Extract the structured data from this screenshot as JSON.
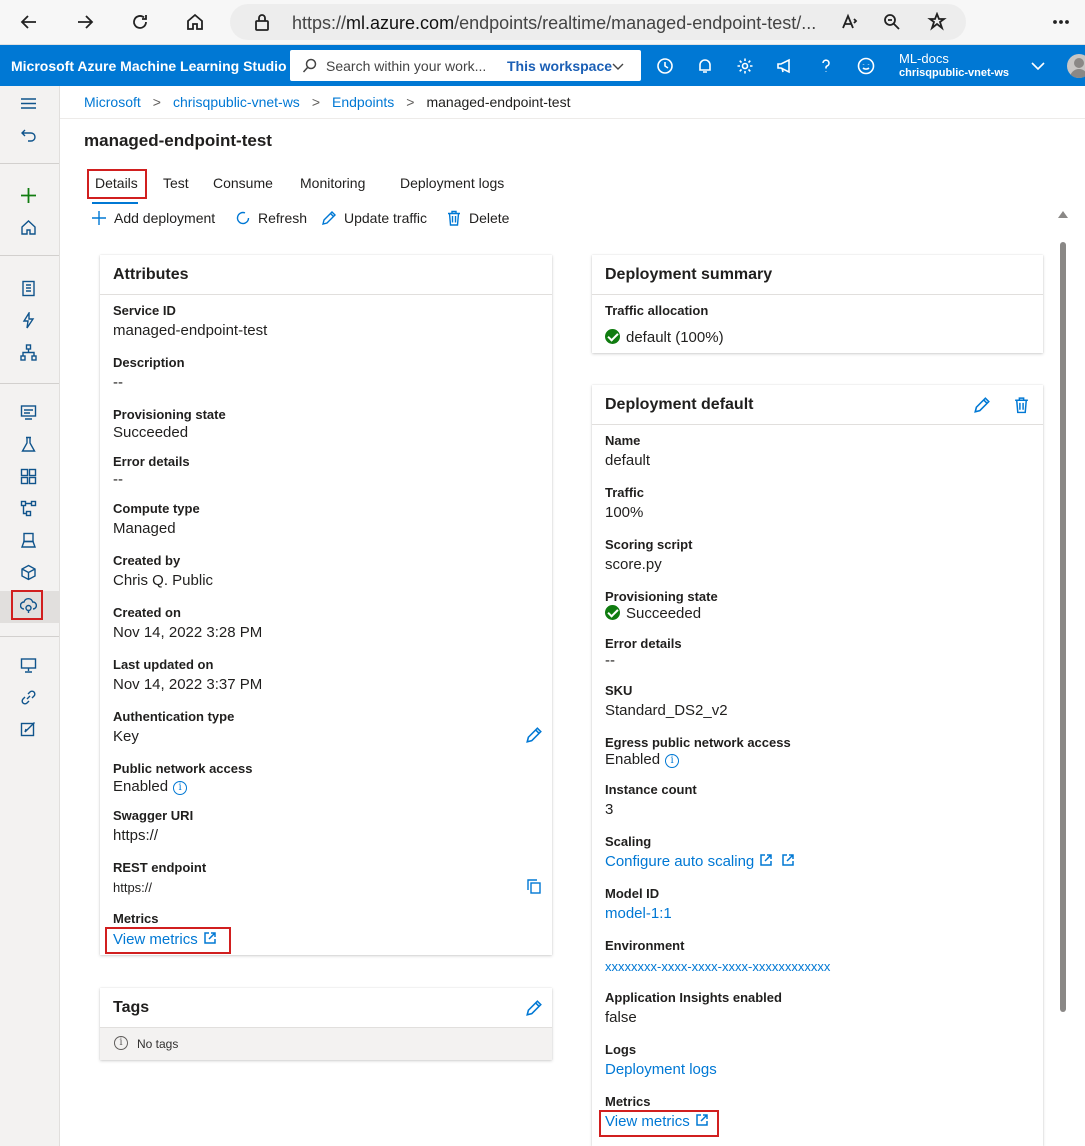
{
  "browser": {
    "url_prefix": "https://",
    "url_host": "ml.azure.com",
    "url_path": "/endpoints/realtime/managed-endpoint-test/..."
  },
  "header": {
    "app_title": "Microsoft Azure Machine Learning Studio",
    "search_placeholder": "Search within your work...",
    "search_scope": "This workspace",
    "account_name": "ML-docs",
    "account_workspace": "chrisqpublic-vnet-ws"
  },
  "breadcrumb": {
    "items": [
      "Microsoft",
      "chrisqpublic-vnet-ws",
      "Endpoints"
    ],
    "current": "managed-endpoint-test"
  },
  "page": {
    "title": "managed-endpoint-test",
    "tabs": [
      "Details",
      "Test",
      "Consume",
      "Monitoring",
      "Deployment logs"
    ],
    "active_tab": "Details",
    "commands": {
      "add_deployment": "Add deployment",
      "refresh": "Refresh",
      "update_traffic": "Update traffic",
      "delete": "Delete"
    }
  },
  "attributes": {
    "title": "Attributes",
    "service_id_label": "Service ID",
    "service_id": "managed-endpoint-test",
    "description_label": "Description",
    "description": "--",
    "provisioning_label": "Provisioning state",
    "provisioning": "Succeeded",
    "error_label": "Error details",
    "error": "--",
    "compute_label": "Compute type",
    "compute": "Managed",
    "created_by_label": "Created by",
    "created_by": "Chris Q. Public",
    "created_on_label": "Created on",
    "created_on": "Nov 14, 2022 3:28 PM",
    "updated_label": "Last updated on",
    "updated": "Nov 14, 2022 3:37 PM",
    "auth_label": "Authentication type",
    "auth": "Key",
    "network_label": "Public network access",
    "network": "Enabled",
    "swagger_label": "Swagger URI",
    "swagger": "https://",
    "rest_label": "REST endpoint",
    "rest": "https://",
    "metrics_label": "Metrics",
    "metrics_link": "View metrics"
  },
  "tags": {
    "title": "Tags",
    "empty": "No tags"
  },
  "summary": {
    "title": "Deployment summary",
    "traffic_label": "Traffic allocation",
    "traffic": "default (100%)"
  },
  "deployment": {
    "title": "Deployment default",
    "name_label": "Name",
    "name": "default",
    "traffic_label": "Traffic",
    "traffic": "100%",
    "scoring_label": "Scoring script",
    "scoring": "score.py",
    "provisioning_label": "Provisioning state",
    "provisioning": "Succeeded",
    "error_label": "Error details",
    "error": "--",
    "sku_label": "SKU",
    "sku": "Standard_DS2_v2",
    "egress_label": "Egress public network access",
    "egress": "Enabled",
    "instance_label": "Instance count",
    "instance": "3",
    "scaling_label": "Scaling",
    "scaling_link": "Configure auto scaling",
    "model_label": "Model ID",
    "model": "model-1:1",
    "environment_label": "Environment",
    "environment": "xxxxxxxx-xxxx-xxxx-xxxx-xxxxxxxxxxxx",
    "insights_label": "Application Insights enabled",
    "insights": "false",
    "logs_label": "Logs",
    "logs_link": "Deployment logs",
    "metrics_label": "Metrics",
    "metrics_link": "View metrics"
  }
}
